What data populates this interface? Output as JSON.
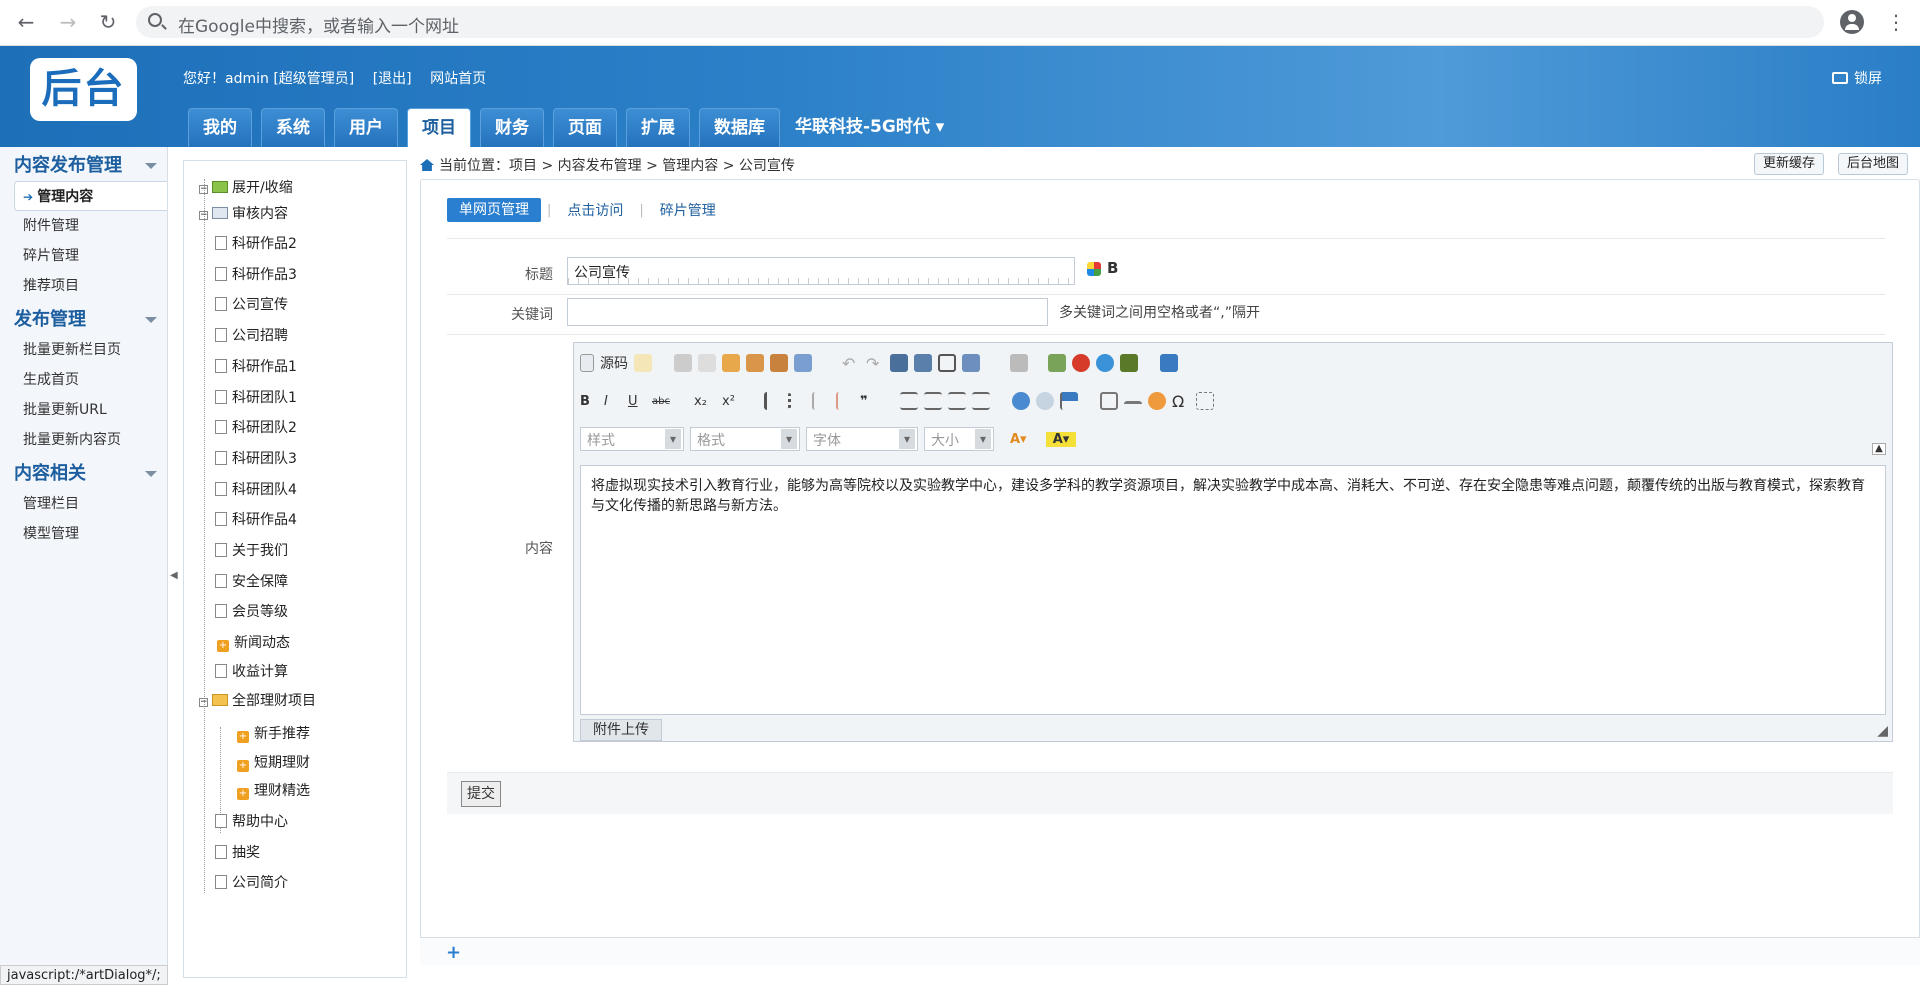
{
  "browser": {
    "omnibox_placeholder": "在Google中搜索，或者输入一个网址"
  },
  "header": {
    "logo_text": "后台",
    "greeting": "您好！admin [超级管理员]",
    "logout": "[退出]",
    "site_home": "网站首页",
    "lock": "锁屏",
    "tabs": [
      "我的",
      "系统",
      "用户",
      "项目",
      "财务",
      "页面",
      "扩展",
      "数据库"
    ],
    "active_tab": "项目",
    "brand": "华联科技-5G时代"
  },
  "sidebar": {
    "sections": [
      {
        "title": "内容发布管理",
        "items": [
          "管理内容",
          "附件管理",
          "碎片管理",
          "推荐项目"
        ]
      },
      {
        "title": "发布管理",
        "items": [
          "批量更新栏目页",
          "生成首页",
          "批量更新URL",
          "批量更新内容页"
        ]
      },
      {
        "title": "内容相关",
        "items": [
          "管理栏目",
          "模型管理"
        ]
      }
    ],
    "active_item": "管理内容"
  },
  "tree": {
    "root": "展开/收缩",
    "audit": "审核内容",
    "pages": [
      "科研作品2",
      "科研作品3",
      "公司宣传",
      "公司招聘",
      "科研作品1",
      "科研团队1",
      "科研团队2",
      "科研团队3",
      "科研团队4",
      "科研作品4",
      "关于我们",
      "安全保障",
      "会员等级"
    ],
    "news": "新闻动态",
    "income": "收益计算",
    "finance": "全部理财项目",
    "finance_children": [
      "新手推荐",
      "短期理财",
      "理财精选"
    ],
    "tail": [
      "帮助中心",
      "抽奖",
      "公司简介"
    ]
  },
  "main": {
    "breadcrumb": "当前位置：项目 > 内容发布管理 > 管理内容 > 公司宣传",
    "update_cache": "更新缓存",
    "site_map": "后台地图",
    "subtabs": [
      "单网页管理",
      "点击访问",
      "碎片管理"
    ],
    "title_label": "标题",
    "title_value": "公司宣传",
    "keywords_label": "关键词",
    "keywords_hint": "多关键词之间用空格或者“,”隔开",
    "content_label": "内容",
    "toolbar_source": "源码",
    "combos": [
      "样式",
      "格式",
      "字体",
      "大小"
    ],
    "content_text": "将虚拟现实技术引入教育行业，能够为高等院校以及实验教学中心，建设多学科的教学资源项目，解决实验教学中成本高、消耗大、不可逆、存在安全隐患等难点问题，颠覆传统的出版与教育模式，探索教育与文化传播的新思路与新方法。",
    "attach_upload": "附件上传",
    "submit": "提交"
  },
  "status": "javascript:/*artDialog*/;"
}
